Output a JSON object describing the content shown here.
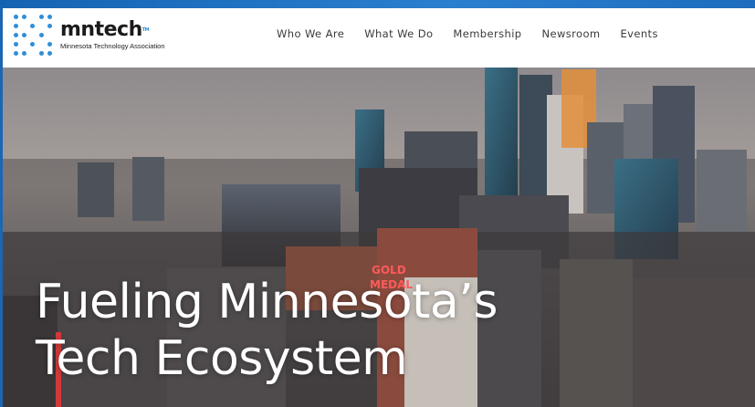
{
  "header": {
    "logo": {
      "wordmark": "mntech",
      "tagline": "Minnesota Technology Association",
      "brand_color": "#2f8fd8"
    },
    "nav": [
      {
        "label": "Who We Are"
      },
      {
        "label": "What We Do"
      },
      {
        "label": "Membership"
      },
      {
        "label": "Newsroom"
      },
      {
        "label": "Events"
      }
    ]
  },
  "hero": {
    "title_line1": "Fueling Minnesota’s",
    "title_line2": "Tech Ecosystem",
    "background": "city-skyline-photo"
  }
}
